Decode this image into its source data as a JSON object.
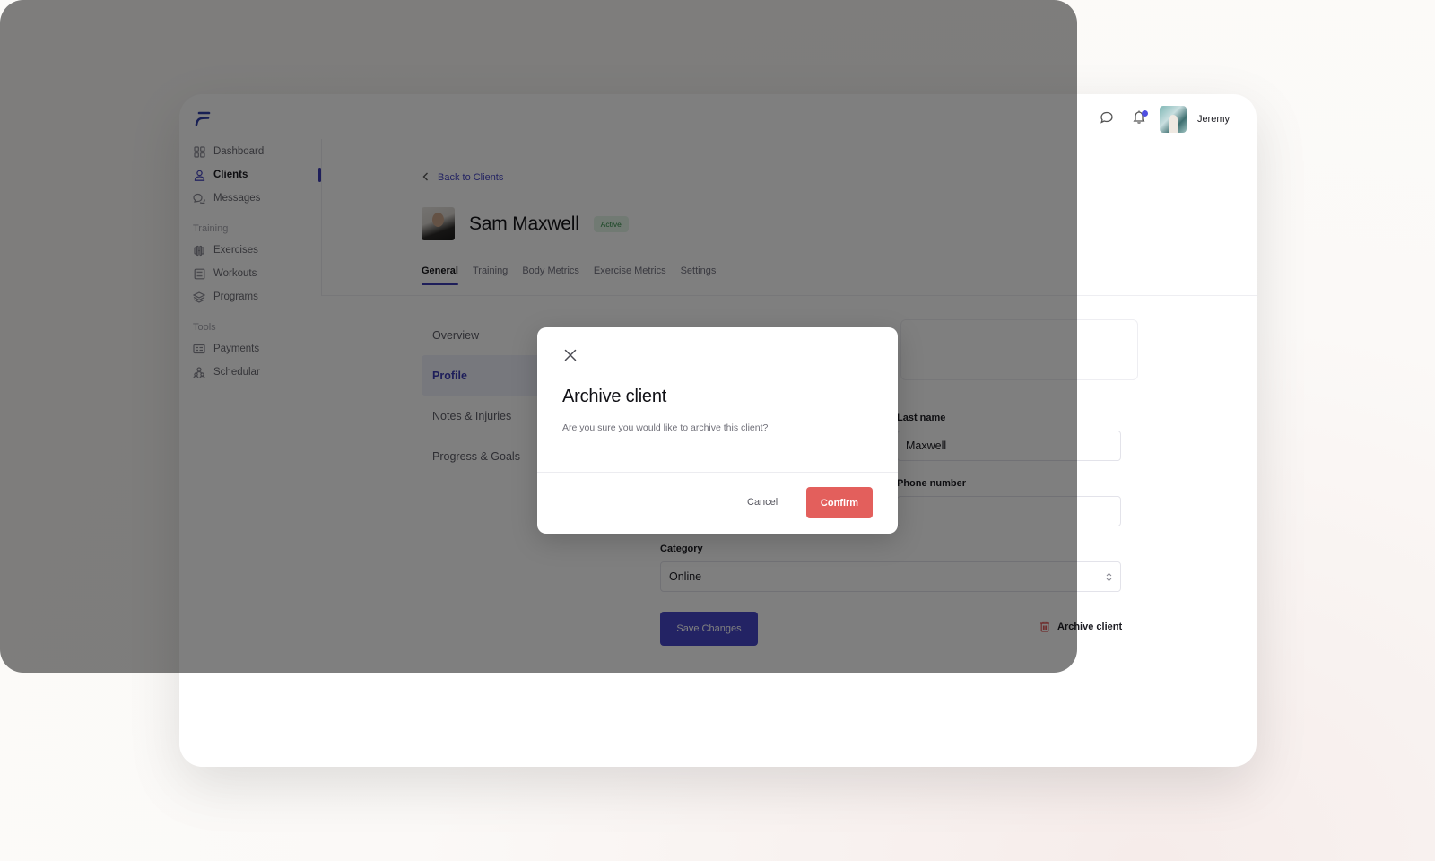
{
  "app": {
    "user_name": "Jeremy",
    "notification_dot": true,
    "accent_color": "#4646c8",
    "danger_color": "#e35f5c"
  },
  "sidebar": {
    "items": [
      {
        "label": "Dashboard",
        "icon": "grid-icon",
        "active": false
      },
      {
        "label": "Clients",
        "icon": "user-icon",
        "active": true
      },
      {
        "label": "Messages",
        "icon": "messages-icon",
        "active": false
      }
    ],
    "groups": [
      {
        "title": "Training",
        "items": [
          {
            "label": "Exercises",
            "icon": "dumbbell-icon"
          },
          {
            "label": "Workouts",
            "icon": "list-icon"
          },
          {
            "label": "Programs",
            "icon": "layers-icon"
          }
        ]
      },
      {
        "title": "Tools",
        "items": [
          {
            "label": "Payments",
            "icon": "card-icon"
          },
          {
            "label": "Schedular",
            "icon": "people-icon"
          }
        ]
      }
    ]
  },
  "main": {
    "back_label": "Back to Clients",
    "client_name": "Sam Maxwell",
    "status_badge": "Active",
    "tabs": [
      {
        "label": "General",
        "active": true
      },
      {
        "label": "Training",
        "active": false
      },
      {
        "label": "Body Metrics",
        "active": false
      },
      {
        "label": "Exercise Metrics",
        "active": false
      },
      {
        "label": "Settings",
        "active": false
      }
    ],
    "subnav": [
      {
        "label": "Overview",
        "active": false
      },
      {
        "label": "Profile",
        "active": true
      },
      {
        "label": "Notes & Injuries",
        "active": false
      },
      {
        "label": "Progress & Goals",
        "active": false
      }
    ],
    "form": {
      "last_name_label": "Last name",
      "last_name_value": "Maxwell",
      "phone_label": "Phone number",
      "phone_value": "",
      "category_label": "Category",
      "category_value": "Online",
      "save_label": "Save Changes",
      "archive_label": "Archive client"
    }
  },
  "modal": {
    "title": "Archive client",
    "message": "Are you sure you would like to archive this client?",
    "cancel_label": "Cancel",
    "confirm_label": "Confirm"
  }
}
